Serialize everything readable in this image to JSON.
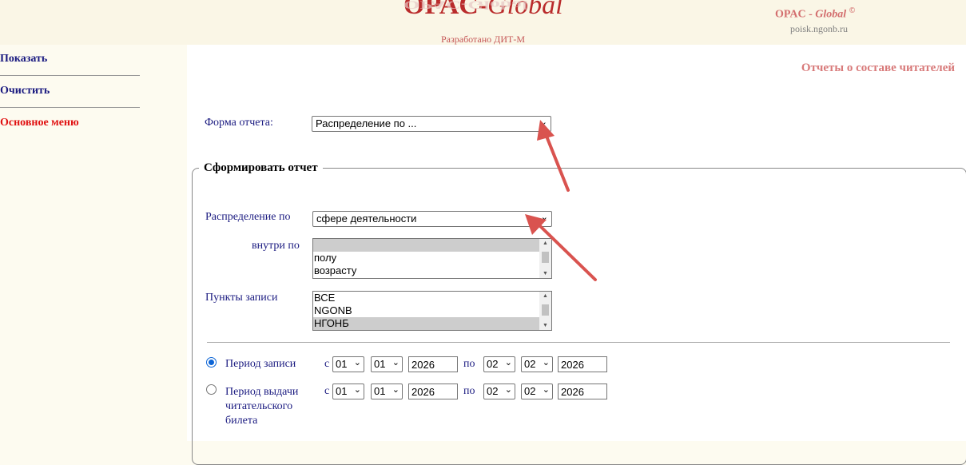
{
  "header": {
    "logo_main": "OPAC-",
    "logo_italic": "Global",
    "dev_text": "Разработано ДИТ-М",
    "brand_prefix": "OPAC - ",
    "brand_italic": "Global",
    "brand_sup": "©",
    "site": "poisk.ngonb.ru"
  },
  "sidebar": {
    "items": [
      {
        "label": "Показать"
      },
      {
        "label": "Очистить"
      },
      {
        "label": "Основное меню"
      }
    ]
  },
  "main": {
    "report_title": "Отчеты о составе читателей",
    "form_label": "Форма отчета:",
    "form_value": "Распределение по ...",
    "legend": "Сформировать отчет",
    "dist_label": "Распределение по",
    "dist_value": "сфере деятельности",
    "inner_label": "внутри по",
    "inner_options": [
      "",
      "полу",
      "возрасту"
    ],
    "points_label": "Пункты записи",
    "points_options": [
      "ВСЕ",
      "NGONB",
      "НГОНБ"
    ],
    "period1": {
      "label": "Период записи",
      "from": "с",
      "to": "по",
      "d1": "01",
      "m1": "01",
      "y1": "2026",
      "d2": "02",
      "m2": "02",
      "y2": "2026"
    },
    "period2": {
      "label_line1": "Период выдачи",
      "label_line2": "читательского",
      "label_line3": "билета",
      "from": "с",
      "to": "по",
      "d1": "01",
      "m1": "01",
      "y1": "2026",
      "d2": "02",
      "m2": "02",
      "y2": "2026"
    }
  },
  "colors": {
    "arrow": "#d9534f",
    "accent": "#1a1a80",
    "brand": "#b92b2b"
  }
}
